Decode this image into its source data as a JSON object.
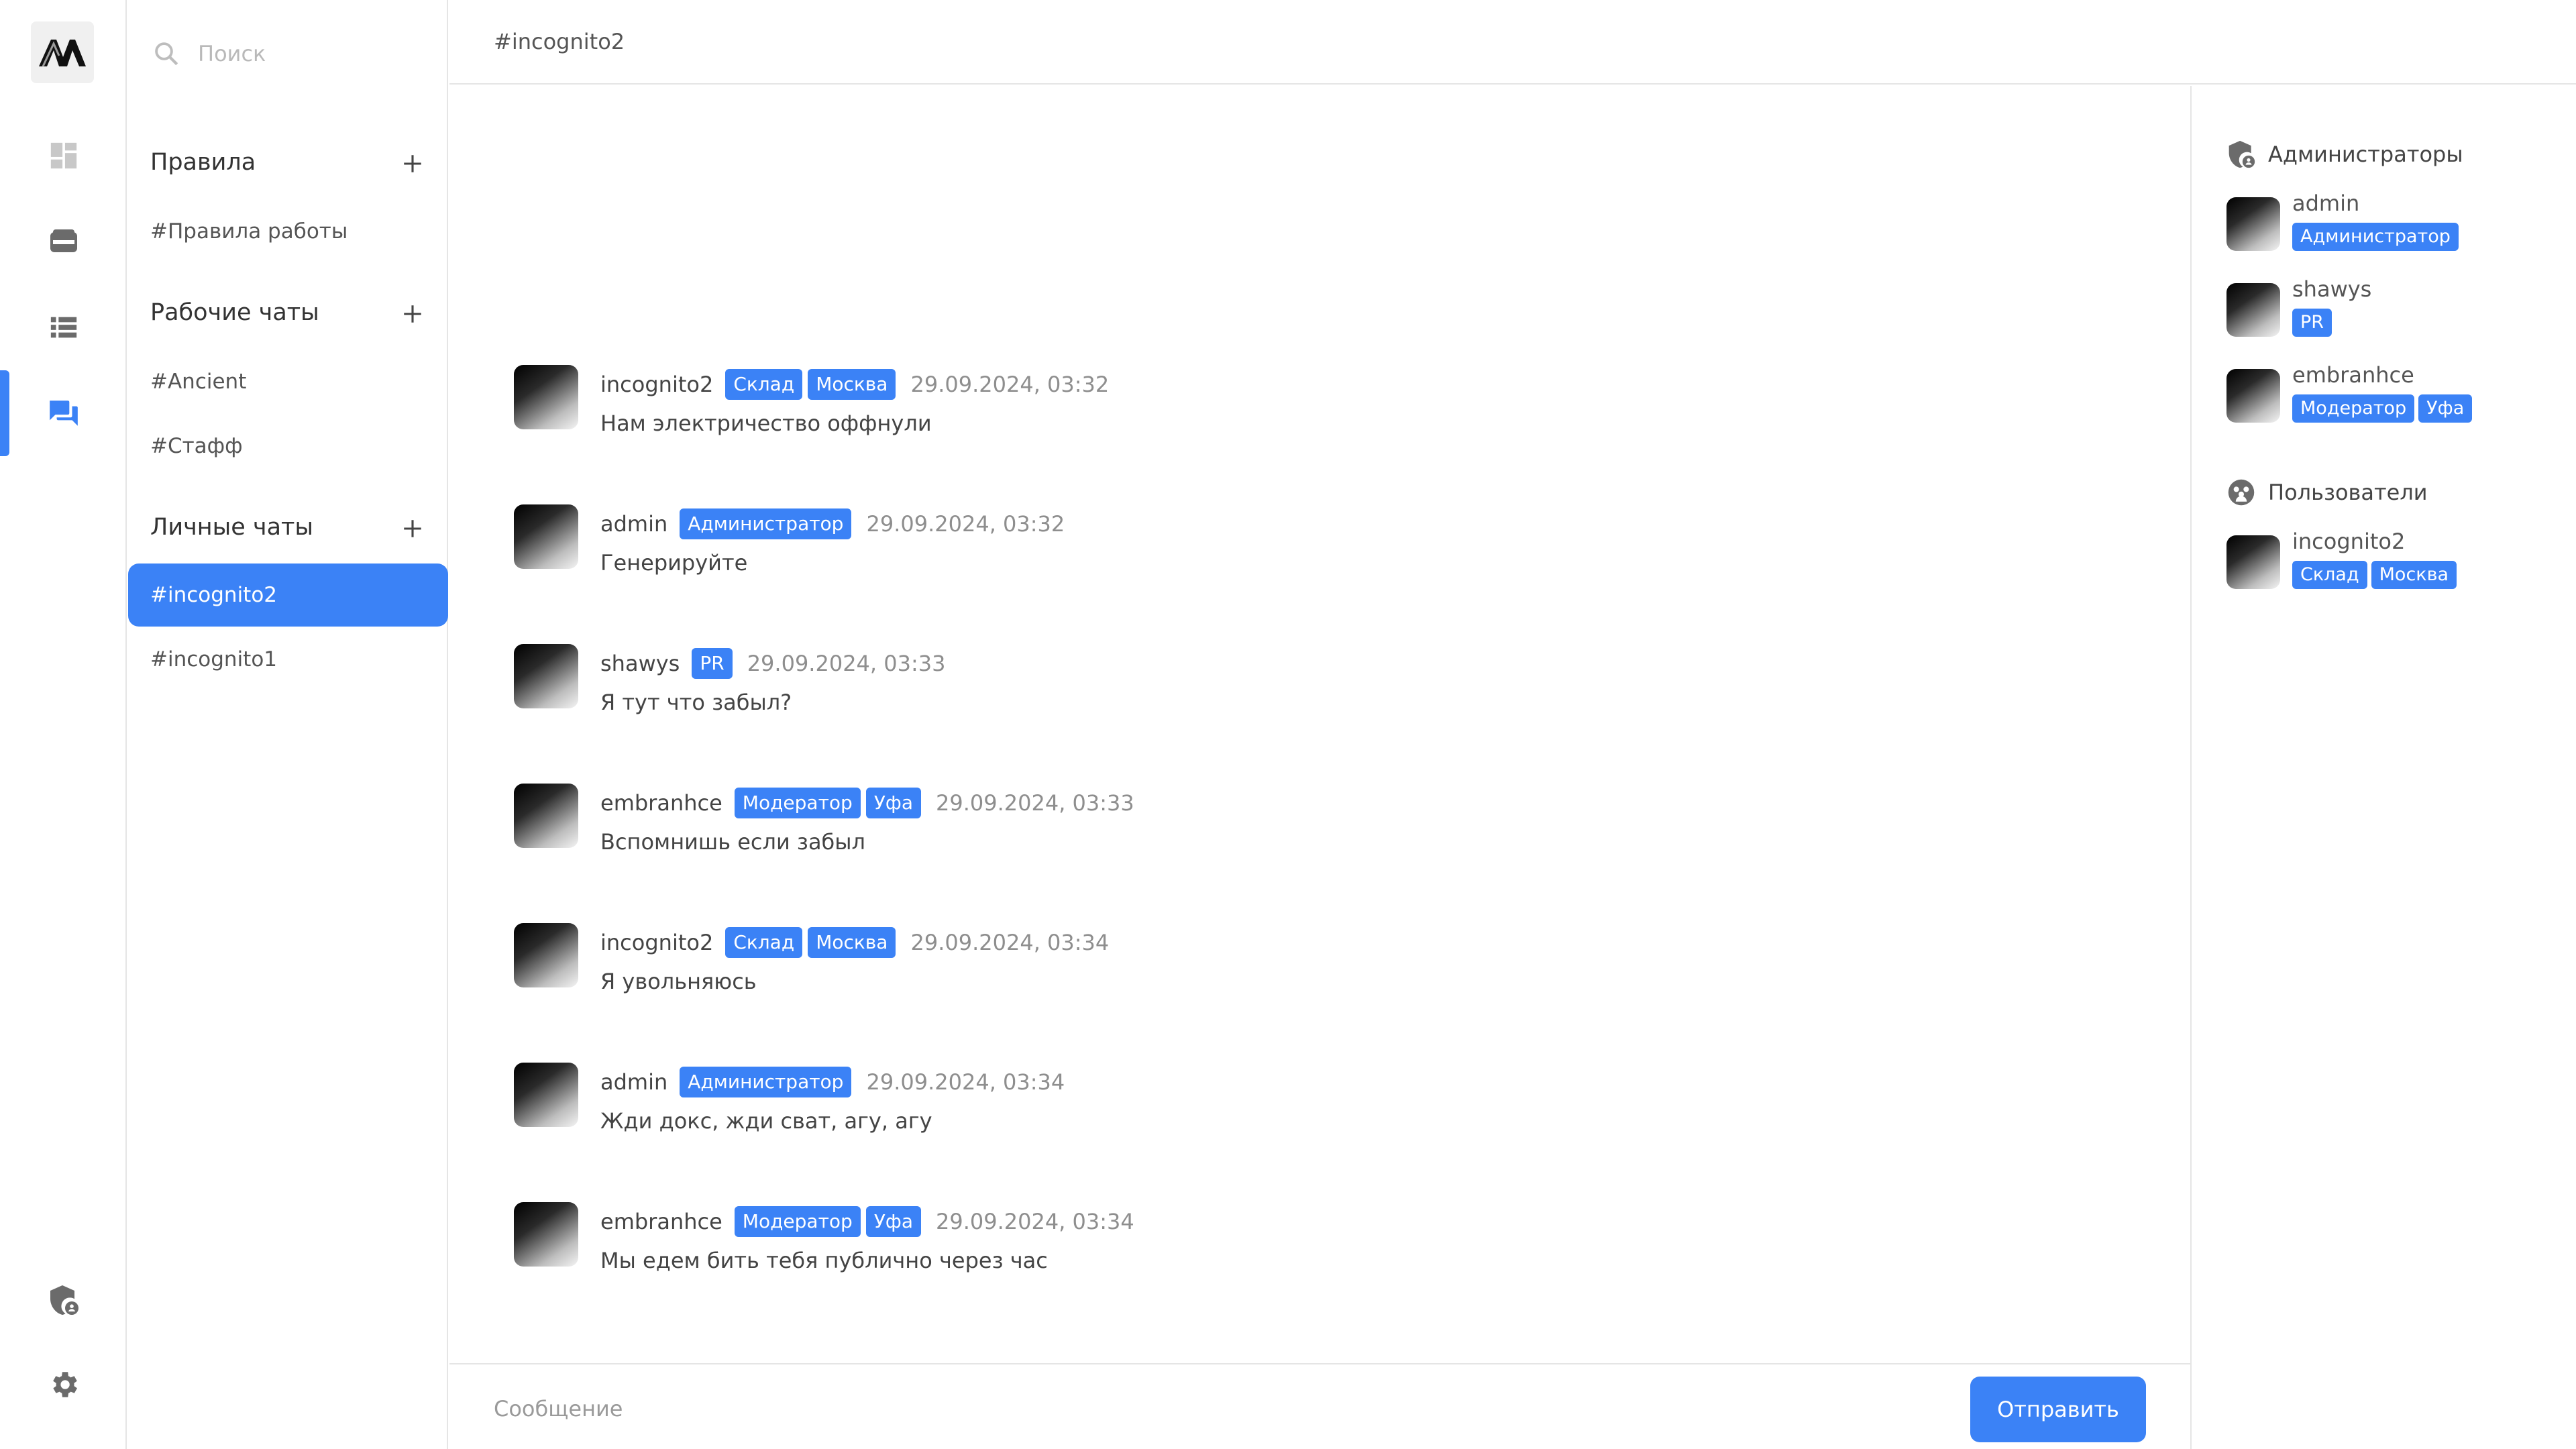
{
  "colors": {
    "accent": "#3b82f6",
    "border": "#e5e5e5",
    "muted": "#8e8e8e"
  },
  "rail": {
    "logo": "AA",
    "icons": [
      "dashboard-icon",
      "wallet-icon",
      "list-icon",
      "chat-icon",
      "security-user-icon",
      "gear-icon"
    ]
  },
  "search": {
    "placeholder": "Поиск"
  },
  "sections": [
    {
      "title": "Правила",
      "channels": [
        {
          "label": "#Правила работы"
        }
      ]
    },
    {
      "title": "Рабочие чаты",
      "channels": [
        {
          "label": "#Ancient"
        },
        {
          "label": "#Стафф"
        }
      ]
    },
    {
      "title": "Личные чаты",
      "channels": [
        {
          "label": "#incognito2",
          "active": true
        },
        {
          "label": "#incognito1"
        }
      ]
    }
  ],
  "header": {
    "title": "#incognito2"
  },
  "messages": [
    {
      "user": "incognito2",
      "tags": [
        "Склад",
        "Москва"
      ],
      "time": "29.09.2024, 03:32",
      "text": "Нам электричество оффнули"
    },
    {
      "user": "admin",
      "tags": [
        "Администратор"
      ],
      "time": "29.09.2024, 03:32",
      "text": "Генерируйте"
    },
    {
      "user": "shawys",
      "tags": [
        "PR"
      ],
      "time": "29.09.2024, 03:33",
      "text": "Я тут что забыл?"
    },
    {
      "user": "embranhce",
      "tags": [
        "Модератор",
        "Уфа"
      ],
      "time": "29.09.2024, 03:33",
      "text": "Вспомнишь если забыл"
    },
    {
      "user": "incognito2",
      "tags": [
        "Склад",
        "Москва"
      ],
      "time": "29.09.2024, 03:34",
      "text": "Я увольняюсь"
    },
    {
      "user": "admin",
      "tags": [
        "Администратор"
      ],
      "time": "29.09.2024, 03:34",
      "text": "Жди докс, жди сват, агу, агу"
    },
    {
      "user": "embranhce",
      "tags": [
        "Модератор",
        "Уфа"
      ],
      "time": "29.09.2024, 03:34",
      "text": "Мы едем бить тебя публично через час"
    }
  ],
  "composer": {
    "placeholder": "Сообщение",
    "send_label": "Отправить"
  },
  "members": {
    "admins_title": "Администраторы",
    "admins": [
      {
        "name": "admin",
        "tags": [
          "Администратор"
        ]
      },
      {
        "name": "shawys",
        "tags": [
          "PR"
        ]
      },
      {
        "name": "embranhce",
        "tags": [
          "Модератор",
          "Уфа"
        ]
      }
    ],
    "users_title": "Пользователи",
    "users": [
      {
        "name": "incognito2",
        "tags": [
          "Склад",
          "Москва"
        ]
      }
    ]
  }
}
